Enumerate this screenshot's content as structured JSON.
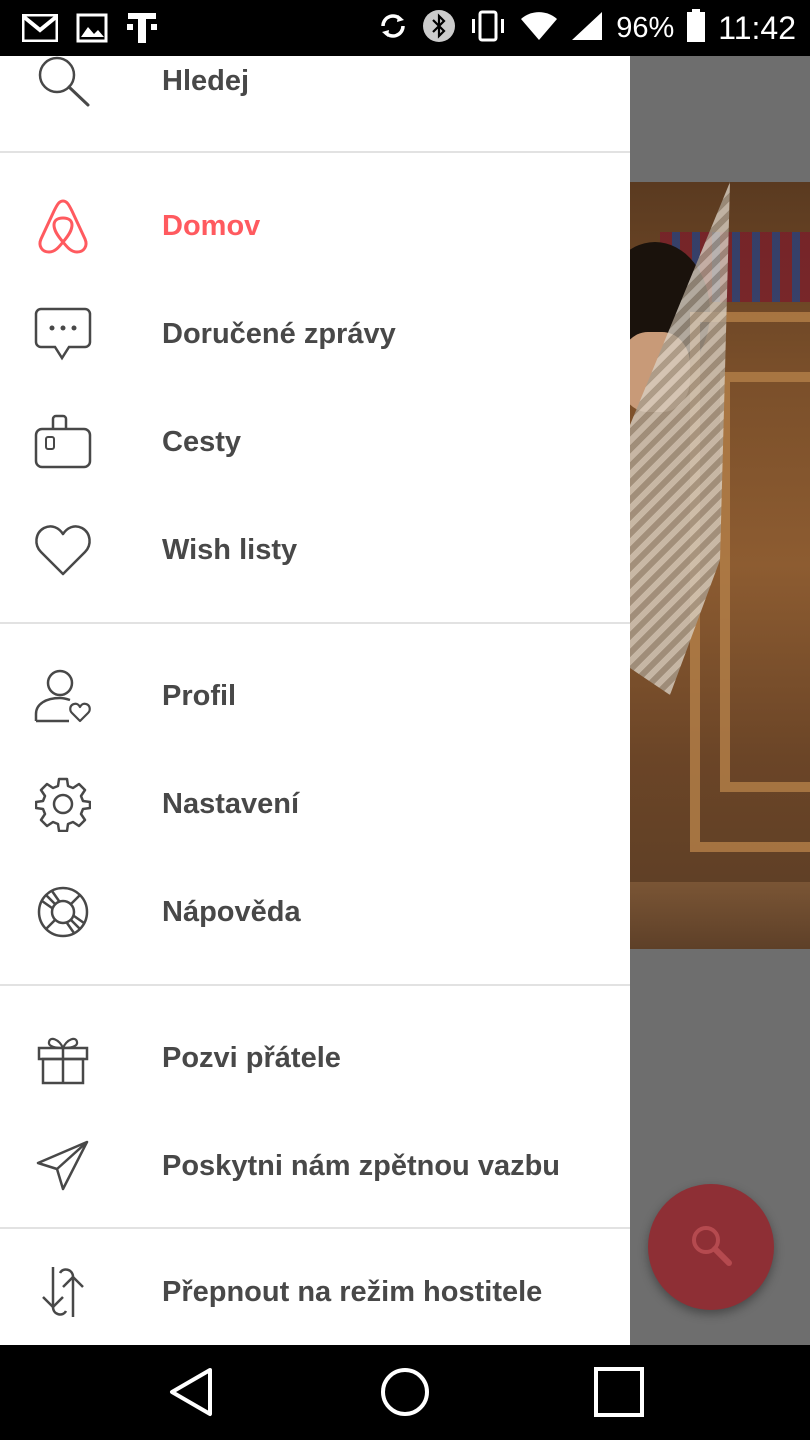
{
  "status_bar": {
    "battery_text": "96%",
    "time": "11:42",
    "left_icons": [
      "gmail-icon",
      "gallery-icon",
      "telekom-icon"
    ],
    "right_icons": [
      "sync-icon",
      "bluetooth-icon",
      "vibrate-icon",
      "wifi-icon",
      "signal-icon",
      "battery-icon"
    ]
  },
  "drawer": {
    "items": [
      {
        "label": "Hledej",
        "icon": "search-icon"
      },
      {
        "label": "Domov",
        "icon": "airbnb-logo-icon",
        "active": true
      },
      {
        "label": "Doručené zprávy",
        "icon": "chat-bubble-icon"
      },
      {
        "label": "Cesty",
        "icon": "suitcase-icon"
      },
      {
        "label": "Wish listy",
        "icon": "heart-icon"
      },
      {
        "label": "Profil",
        "icon": "profile-icon"
      },
      {
        "label": "Nastavení",
        "icon": "gear-icon"
      },
      {
        "label": "Nápověda",
        "icon": "lifebuoy-icon"
      },
      {
        "label": "Pozvi přátele",
        "icon": "gift-icon"
      },
      {
        "label": "Poskytni nám zpětnou vazbu",
        "icon": "paper-plane-icon"
      },
      {
        "label": "Přepnout na režim hostitele",
        "icon": "switch-arrows-icon"
      }
    ]
  },
  "fab": {
    "icon": "search-icon"
  },
  "colors": {
    "accent": "#ff5a5f",
    "text": "#484848",
    "fab": "#8e2f35"
  },
  "nav_bar": {
    "buttons": [
      "back-icon",
      "home-icon",
      "recents-icon"
    ]
  }
}
